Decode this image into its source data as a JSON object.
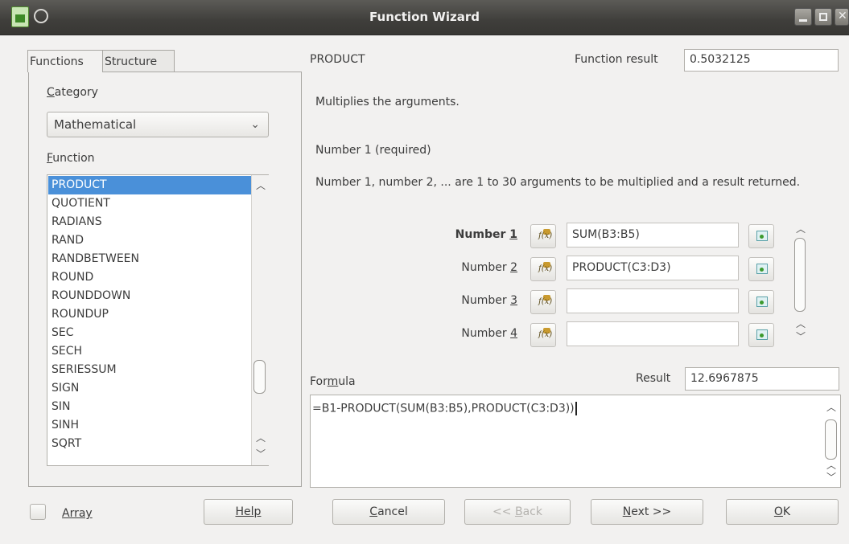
{
  "window": {
    "title": "Function Wizard"
  },
  "tabs": {
    "functions": "Functions",
    "structure": "Structure"
  },
  "category": {
    "label_first": "C",
    "label_rest": "ategory",
    "selected": "Mathematical"
  },
  "function_section": {
    "label_first": "F",
    "label_rest": "unction"
  },
  "function_list": [
    "PRODUCT",
    "QUOTIENT",
    "RADIANS",
    "RAND",
    "RANDBETWEEN",
    "ROUND",
    "ROUNDDOWN",
    "ROUNDUP",
    "SEC",
    "SECH",
    "SERIESSUM",
    "SIGN",
    "SIN",
    "SINH",
    "SQRT"
  ],
  "selected_function": "PRODUCT",
  "function_result": {
    "label": "Function result",
    "value": "0.5032125"
  },
  "description": "Multiplies the arguments.",
  "argument_title": "Number 1 (required)",
  "argument_description": "Number 1, number 2, ... are 1 to 30 arguments to be multiplied and a result returned.",
  "arguments": [
    {
      "label_prefix": "Number ",
      "label_num": "1",
      "value": "SUM(B3:B5)"
    },
    {
      "label_prefix": "Number ",
      "label_num": "2",
      "value": "PRODUCT(C3:D3)"
    },
    {
      "label_prefix": "Number ",
      "label_num": "3",
      "value": ""
    },
    {
      "label_prefix": "Number ",
      "label_num": "4",
      "value": ""
    }
  ],
  "formula": {
    "label_a": "For",
    "label_u": "m",
    "label_b": "ula",
    "value": "=B1-PRODUCT(SUM(B3:B5),PRODUCT(C3:D3))"
  },
  "result": {
    "label": "Result",
    "value": "12.6967875"
  },
  "buttons": {
    "array": "Array",
    "help": "Help",
    "cancel_first": "C",
    "cancel_rest": "ancel",
    "back_a": "<< ",
    "back_u": "B",
    "back_b": "ack",
    "next_u": "N",
    "next_rest": "ext >>",
    "ok_u": "O",
    "ok_rest": "K"
  }
}
